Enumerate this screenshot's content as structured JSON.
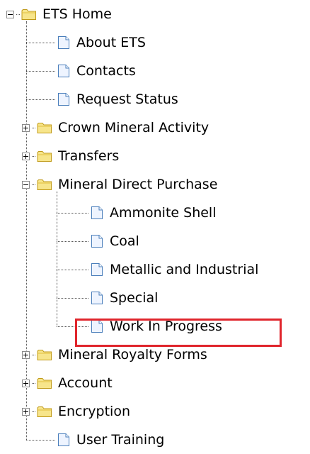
{
  "tree": {
    "nodes": [
      {
        "label": "ETS Home",
        "type": "folder",
        "expander": "minus",
        "level": 0
      },
      {
        "label": "About ETS",
        "type": "page",
        "level": 1
      },
      {
        "label": "Contacts",
        "type": "page",
        "level": 1
      },
      {
        "label": "Request Status",
        "type": "page",
        "level": 1
      },
      {
        "label": "Crown Mineral Activity",
        "type": "folder",
        "expander": "plus",
        "level": 1
      },
      {
        "label": "Transfers",
        "type": "folder",
        "expander": "plus",
        "level": 1
      },
      {
        "label": "Mineral Direct Purchase",
        "type": "folder",
        "expander": "minus",
        "level": 1
      },
      {
        "label": "Ammonite Shell",
        "type": "page",
        "level": 2
      },
      {
        "label": "Coal",
        "type": "page",
        "level": 2
      },
      {
        "label": "Metallic and Industrial",
        "type": "page",
        "level": 2
      },
      {
        "label": "Special",
        "type": "page",
        "level": 2
      },
      {
        "label": "Work In Progress",
        "type": "page",
        "level": 2,
        "highlighted": true
      },
      {
        "label": "Mineral Royalty Forms",
        "type": "folder",
        "expander": "plus",
        "level": 1
      },
      {
        "label": "Account",
        "type": "folder",
        "expander": "plus",
        "level": 1
      },
      {
        "label": "Encryption",
        "type": "folder",
        "expander": "plus",
        "level": 1
      },
      {
        "label": "User Training",
        "type": "page",
        "level": 1
      }
    ]
  },
  "colors": {
    "highlight_border": "#e0252c",
    "folder_fill": "#f7e58b",
    "page_border": "#4a7ebb"
  },
  "icons": {
    "folder": "folder-icon",
    "page": "page-icon"
  }
}
